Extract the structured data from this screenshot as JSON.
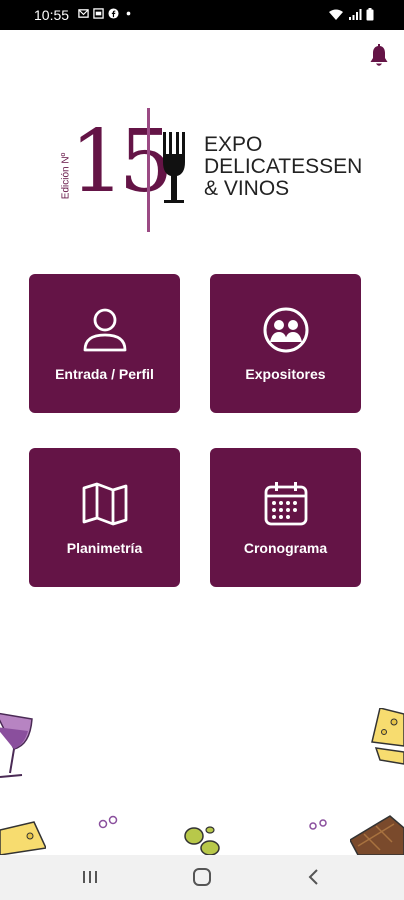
{
  "status_bar": {
    "time": "10:55"
  },
  "logo": {
    "edition_label": "Edición Nº",
    "edition_number": "15",
    "title_lines": [
      "EXPO",
      "DELICATESSEN",
      "& VINOS"
    ]
  },
  "tiles": [
    {
      "label": "Entrada / Perfil",
      "icon": "user-icon"
    },
    {
      "label": "Expositores",
      "icon": "people-circle-icon"
    },
    {
      "label": "Planimetría",
      "icon": "map-icon"
    },
    {
      "label": "Cronograma",
      "icon": "calendar-icon"
    }
  ],
  "colors": {
    "brand": "#641446",
    "accent": "#9b4a84",
    "background": "#ffffff"
  }
}
